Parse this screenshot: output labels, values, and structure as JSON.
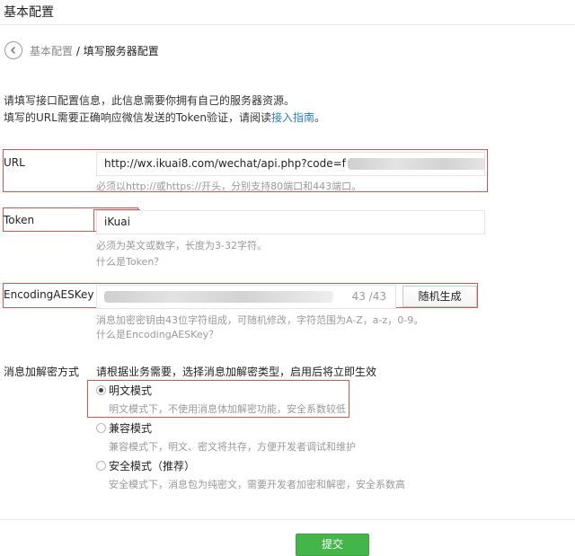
{
  "header": {
    "title": "基本配置"
  },
  "breadcrumb": {
    "parent": "基本配置",
    "separator": " / ",
    "current": "填写服务器配置"
  },
  "intro": {
    "line1": "请填写接口配置信息，此信息需要你拥有自己的服务器资源。",
    "line2_prefix": "填写的URL需要正确响应微信发送的Token验证，请阅读",
    "line2_link": "接入指南",
    "line2_suffix": "。"
  },
  "url_field": {
    "label": "URL",
    "value": "http://wx.ikuai8.com/wechat/api.php?code=f",
    "hint": "必须以http://或https://开头，分别支持80端口和443端口。"
  },
  "token_field": {
    "label": "Token",
    "value": "iKuai",
    "hint": "必须为英文或数字，长度为3-32字符。",
    "help_link": "什么是Token？"
  },
  "aes_field": {
    "label": "EncodingAESKey",
    "value_prefix": "",
    "counter": "43 /43",
    "random_button": "随机生成",
    "hint": "消息加密密钥由43位字符组成，可随机修改，字符范围为A-Z，a-z，0-9。",
    "help_link": "什么是EncodingAESKey？"
  },
  "encryption": {
    "label": "消息加解密方式",
    "instruction": "请根据业务需要，选择消息加解密类型，启用后将立即生效",
    "options": [
      {
        "title": "明文模式",
        "desc": "明文模式下，不使用消息体加解密功能，安全系数较低",
        "selected": true
      },
      {
        "title": "兼容模式",
        "desc": "兼容模式下，明文、密文将共存，方便开发者调试和维护",
        "selected": false
      },
      {
        "title": "安全模式（推荐）",
        "desc": "安全模式下，消息包为纯密文，需要开发者加密和解密，安全系数高",
        "selected": false
      }
    ]
  },
  "submit_button": "提交",
  "colors": {
    "accent": "#44b549",
    "link": "#2a7ec6",
    "highlight": "#d9534f"
  }
}
